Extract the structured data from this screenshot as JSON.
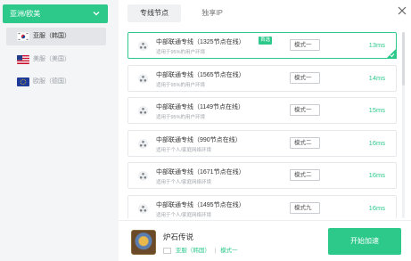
{
  "sidebar": {
    "region_select_label": "亚洲/欧美",
    "regions": [
      {
        "label": "亚服（韩国）",
        "active": true
      },
      {
        "label": "美服（美国）",
        "active": false
      },
      {
        "label": "欧服（德国）",
        "active": false
      }
    ]
  },
  "tabs": [
    {
      "label": "专线节点",
      "active": true
    },
    {
      "label": "独享IP",
      "active": false
    }
  ],
  "nodes": [
    {
      "name": "中部联通专线（1325节点在线）",
      "desc": "适用于95%的用户环境",
      "mode": "模式一",
      "latency": "13ms",
      "recommended": "首选",
      "selected": true
    },
    {
      "name": "中部联通专线（1565节点在线）",
      "desc": "适用于95%的用户环境",
      "mode": "模式一",
      "latency": "14ms",
      "selected": false
    },
    {
      "name": "中部联通专线（1149节点在线）",
      "desc": "适用于95%的用户环境",
      "mode": "模式一",
      "latency": "15ms",
      "selected": false
    },
    {
      "name": "中部联通专线（990节点在线）",
      "desc": "适用于个人/家庭网络环境",
      "mode": "模式二",
      "latency": "16ms",
      "selected": false
    },
    {
      "name": "中部联通专线（1671节点在线）",
      "desc": "适用于个人/家庭网络环境",
      "mode": "模式二",
      "latency": "16ms",
      "selected": false
    },
    {
      "name": "中部联通专线（1495节点在线）",
      "desc": "适用于个人/家庭网络环境",
      "mode": "模式九",
      "latency": "16ms",
      "selected": false
    }
  ],
  "bottom": {
    "game_title": "炉石传说",
    "server": "亚服（韩国）",
    "separator": "|",
    "mode": "模式一",
    "start_label": "开始加速"
  },
  "colors": {
    "accent": "#2dc98b",
    "latency": "#2dc98b"
  }
}
